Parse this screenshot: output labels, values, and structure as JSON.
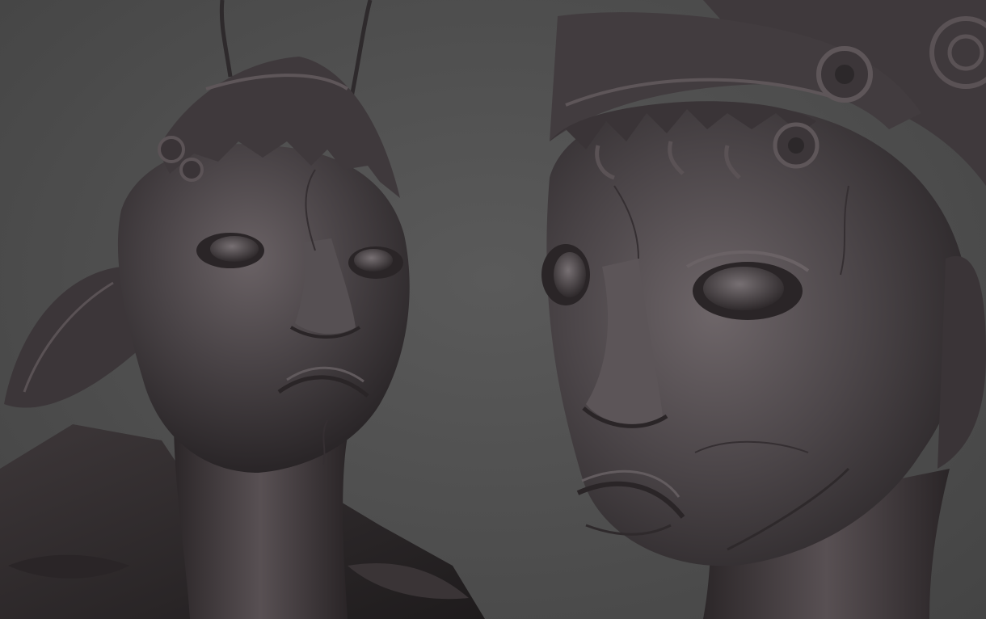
{
  "scene": {
    "background_color": "#4f4f4f",
    "clay_color": "#4a4548",
    "clay_shadow": "#2a2628",
    "clay_highlight": "#6e6669",
    "views": [
      {
        "label": "",
        "subject": "sculpt-bust-three-quarter"
      },
      {
        "label": "",
        "subject": "sculpt-face-closeup"
      }
    ]
  }
}
